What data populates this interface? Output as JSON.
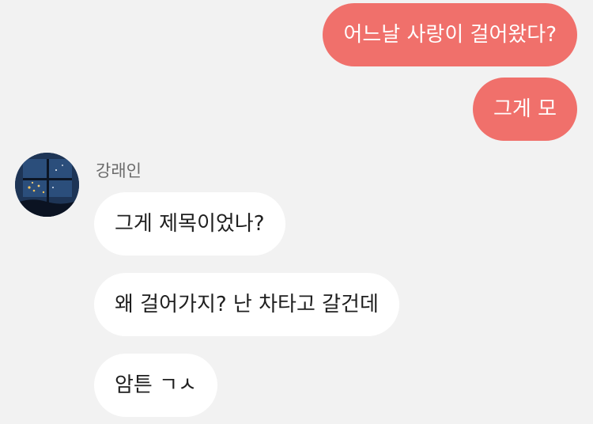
{
  "colors": {
    "background": "#f2f2f2",
    "outgoing_bubble": "#f0706b",
    "incoming_bubble": "#ffffff"
  },
  "outgoing": [
    {
      "text": "어느날 사랑이 걸어왔다?"
    },
    {
      "text": "그게 모"
    }
  ],
  "incoming_group": {
    "sender_name": "강래인",
    "avatar_icon": "avatar-night-window-image",
    "messages": [
      {
        "text": "그게 제목이었나?"
      },
      {
        "text": "왜 걸어가지? 난 차타고 갈건데"
      },
      {
        "text": "암튼 ㄱㅅ"
      }
    ]
  }
}
